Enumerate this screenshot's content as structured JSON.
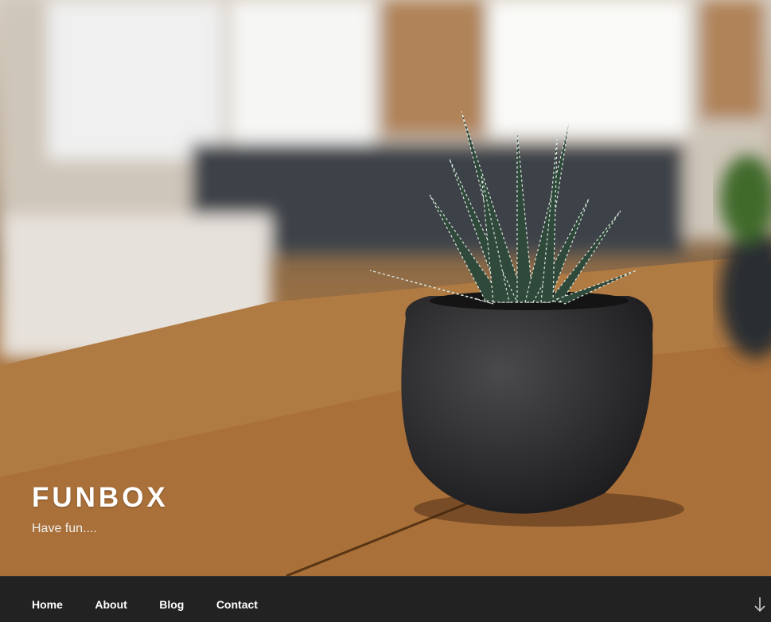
{
  "site": {
    "title": "FUNBOX",
    "tagline": "Have fun...."
  },
  "nav": {
    "items": [
      {
        "label": "Home"
      },
      {
        "label": "About"
      },
      {
        "label": "Blog"
      },
      {
        "label": "Contact"
      }
    ],
    "scroll_icon": "arrow-down-icon"
  },
  "colors": {
    "nav_bg": "#222222",
    "title": "#ffffff"
  }
}
